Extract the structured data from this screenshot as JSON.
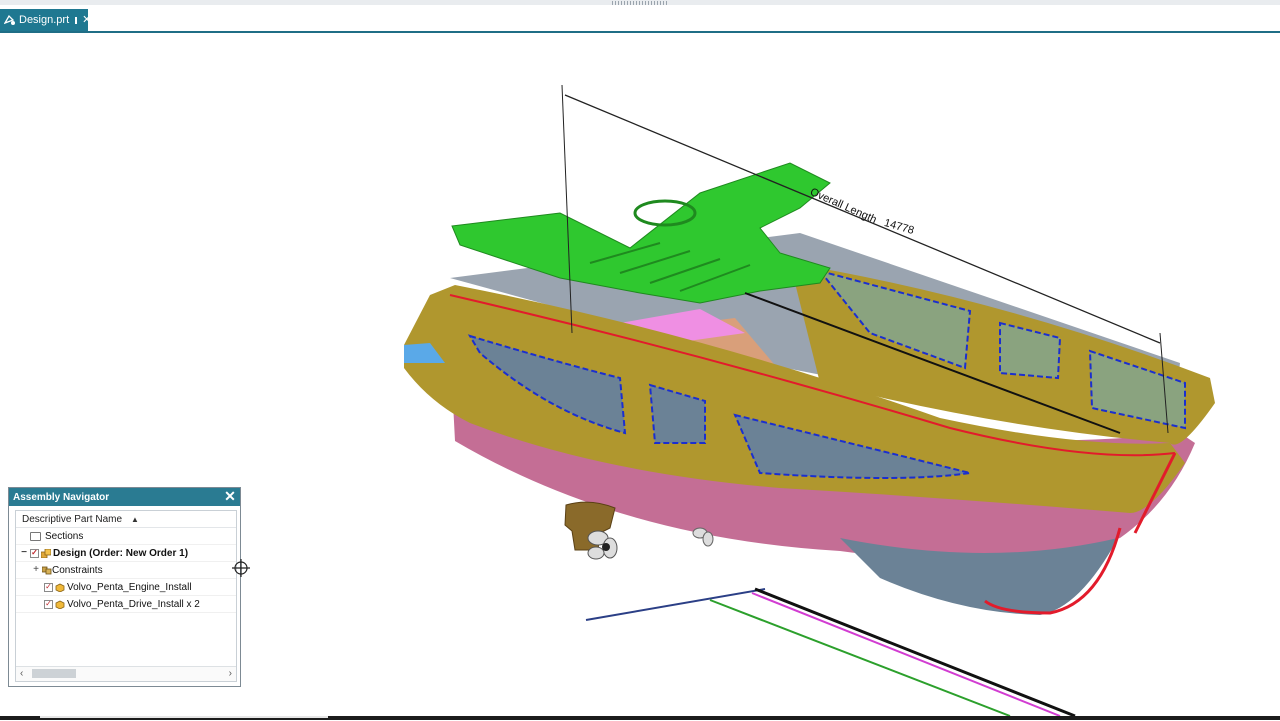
{
  "tab": {
    "title": "Design.prt",
    "pin_icon": "pin-icon",
    "close_icon": "close-icon"
  },
  "viewport": {
    "dimension_label": "Overall Length",
    "dimension_value": "14778",
    "colors": {
      "hull_gold": "#b0972e",
      "hull_pink": "#c46e95",
      "deck_green": "#2fc82f",
      "hull_grey": "#6b8296",
      "section_blue": "#1b2fcf",
      "edge_red": "#e21b2b"
    }
  },
  "assembly_navigator": {
    "title": "Assembly Navigator",
    "column_header": "Descriptive Part Name",
    "sort_icon": "sort-ascending-icon",
    "rows": [
      {
        "label": "Sections"
      },
      {
        "label": "Design (Order: New Order 1)"
      },
      {
        "label": "Constraints"
      },
      {
        "label": "Volvo_Penta_Engine_Install"
      },
      {
        "label": "Volvo_Penta_Drive_Install x 2"
      }
    ]
  }
}
